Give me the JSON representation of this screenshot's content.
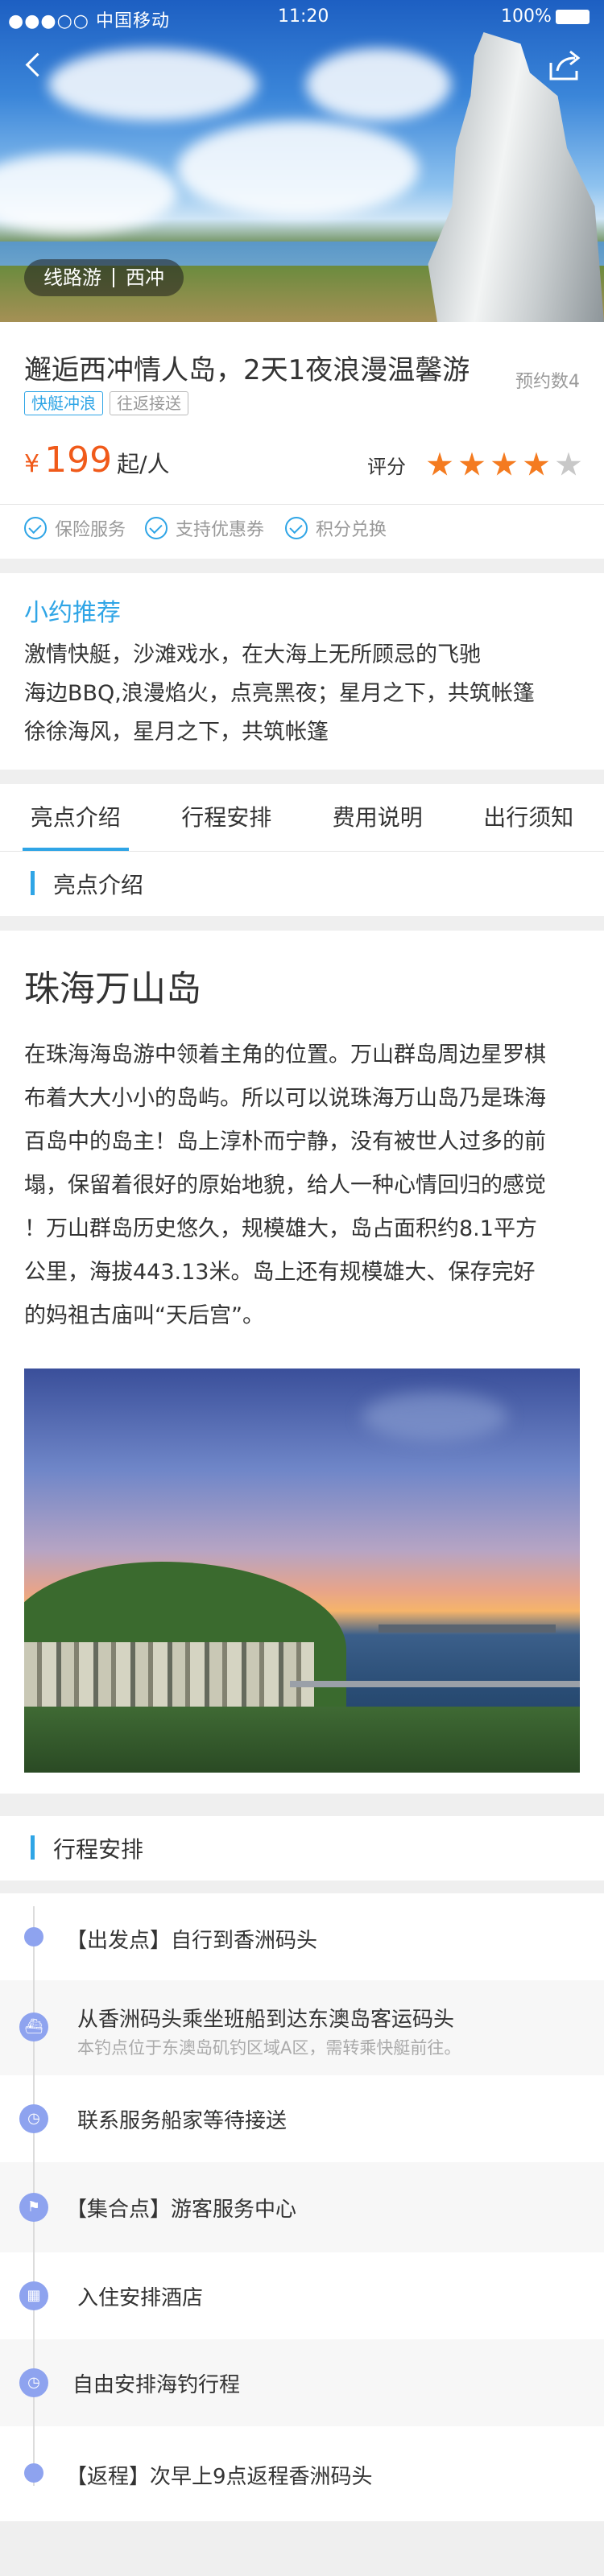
{
  "status_bar": {
    "signal": "●●●○○ 中国移动 ",
    "time": "11:20",
    "battery": "100%"
  },
  "hero": {
    "tag_left": "线路游",
    "tag_right": "西冲"
  },
  "product": {
    "title": "邂逅西冲情人岛，2天1夜浪漫温馨游",
    "booking_count": "预约数4",
    "tags": [
      "快艇冲浪",
      "往返接送"
    ],
    "price_symbol": "¥",
    "price": "199",
    "price_unit": "起/人",
    "rating_label": "评分",
    "rating_value": 4,
    "rating_max": 5
  },
  "services": [
    "保险服务",
    "支持优惠券",
    "积分兑换"
  ],
  "recommend": {
    "heading": "小约推荐",
    "lines": [
      "激情快艇，沙滩戏水，在大海上无所顾忌的飞驰",
      "海边BBQ,浪漫焰火，点亮黑夜；星月之下，共筑帐篷",
      "徐徐海风，星月之下，共筑帐篷"
    ]
  },
  "tabs": [
    "亮点介绍",
    "行程安排",
    "费用说明",
    "出行须知"
  ],
  "highlights": {
    "section_title": "亮点介绍",
    "heading": "珠海万山岛",
    "lines": [
      "在珠海海岛游中领着主角的位置。万山群岛周边星罗棋",
      "布着大大小小的岛屿。所以可以说珠海万山岛乃是珠海",
      "百岛中的岛主！岛上淳朴而宁静，没有被世人过多的前",
      "塌，保留着很好的原始地貌，给人一种心情回归的感觉",
      "！万山群岛历史悠久，规模雄大，岛占面积约8.1平方",
      "公里，海拔443.13米。岛上还有规模雄大、保存完好",
      "的妈祖古庙叫“天后宫”。"
    ]
  },
  "itinerary": {
    "section_title": "行程安排",
    "items": [
      {
        "text": "【出发点】自行到香洲码头",
        "icon": "dot"
      },
      {
        "text": "从香洲码头乘坐班船到达东澳岛客运码头",
        "sub": "本钓点位于东澳岛矶钓区域A区，需转乘快艇前往。",
        "icon": "ship-icon"
      },
      {
        "text": "联系服务船家等待接送",
        "icon": "clock-icon"
      },
      {
        "text": "【集合点】游客服务中心",
        "icon": "flag-icon"
      },
      {
        "text": "入住安排酒店",
        "icon": "hotel-icon"
      },
      {
        "text": "自由安排海钓行程",
        "icon": "clock-icon"
      },
      {
        "text": "【返程】次早上9点返程香洲码头",
        "icon": "dot"
      }
    ]
  },
  "colors": {
    "accent": "#2fa5e6",
    "price": "#f05a1a",
    "star_on": "#f47b20",
    "star_off": "#c8c8c8",
    "timeline": "#8ea3ef"
  }
}
